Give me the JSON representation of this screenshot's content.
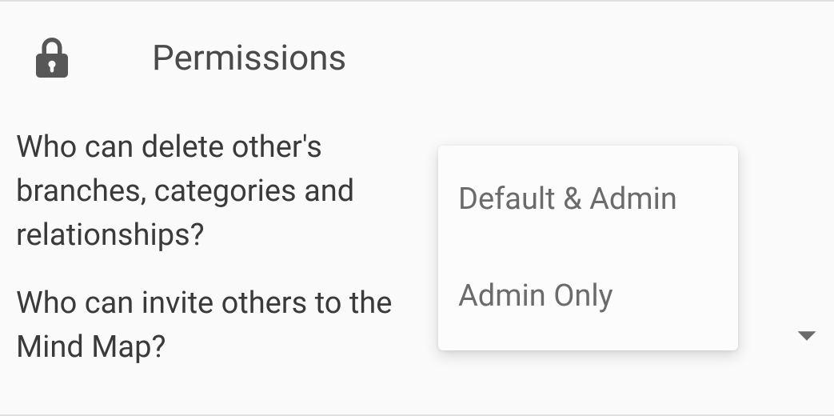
{
  "section": {
    "title": "Permissions"
  },
  "rows": [
    {
      "label": "Who can delete other's branches, categories and relationships?",
      "value": "Default & Admin"
    },
    {
      "label": "Who can invite others to the Mind Map?",
      "value": "Admin Only"
    }
  ],
  "dropdown": {
    "options": [
      "Default & Admin",
      "Admin Only"
    ]
  }
}
